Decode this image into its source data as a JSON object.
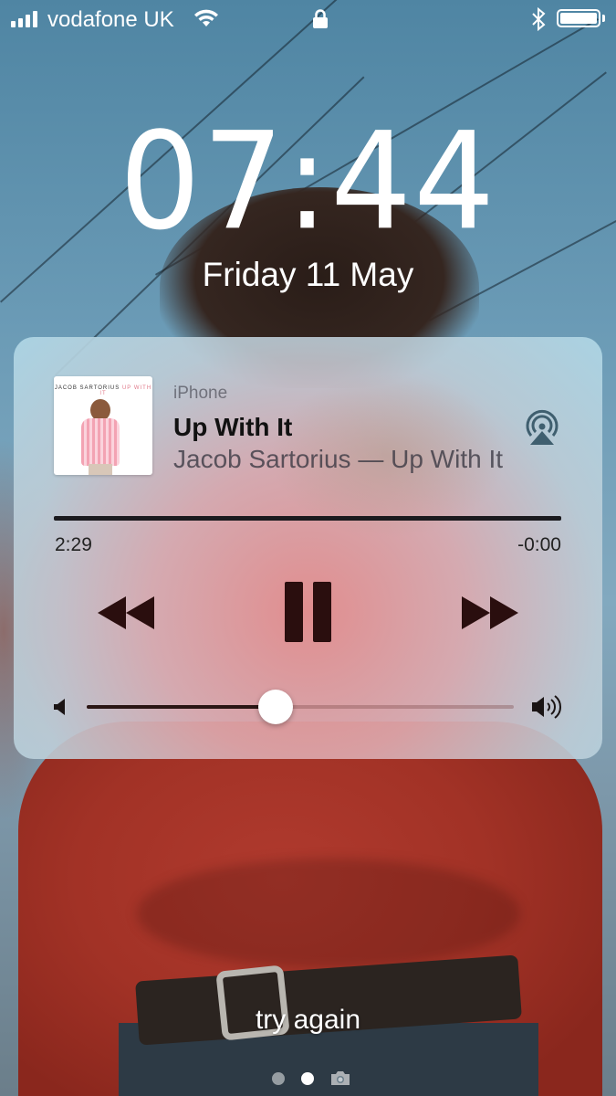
{
  "status_bar": {
    "carrier": "vodafone UK",
    "signal_bars": 4,
    "battery_level": 1.0,
    "icons": [
      "signal-icon",
      "wifi-icon",
      "lock-icon",
      "bluetooth-icon",
      "battery-icon"
    ]
  },
  "lock_screen": {
    "time": "07:44",
    "date": "Friday 11 May",
    "message": "try again"
  },
  "now_playing": {
    "source": "iPhone",
    "track_title": "Up With It",
    "artist_album": "Jacob Sartorius — Up With It",
    "album_art_text": "JACOB SARTORIUS",
    "album_art_text_accent": "UP WITH IT",
    "elapsed": "2:29",
    "remaining": "-0:00",
    "progress": 1.0,
    "volume": 0.45,
    "controls": [
      "rewind-button",
      "pause-button",
      "fast-forward-button"
    ]
  },
  "page_indicator": {
    "pages": 3,
    "current": 2,
    "last_icon": "camera-icon"
  },
  "colors": {
    "widget_accent": "#1b1a1e",
    "text_white": "#ffffff"
  }
}
